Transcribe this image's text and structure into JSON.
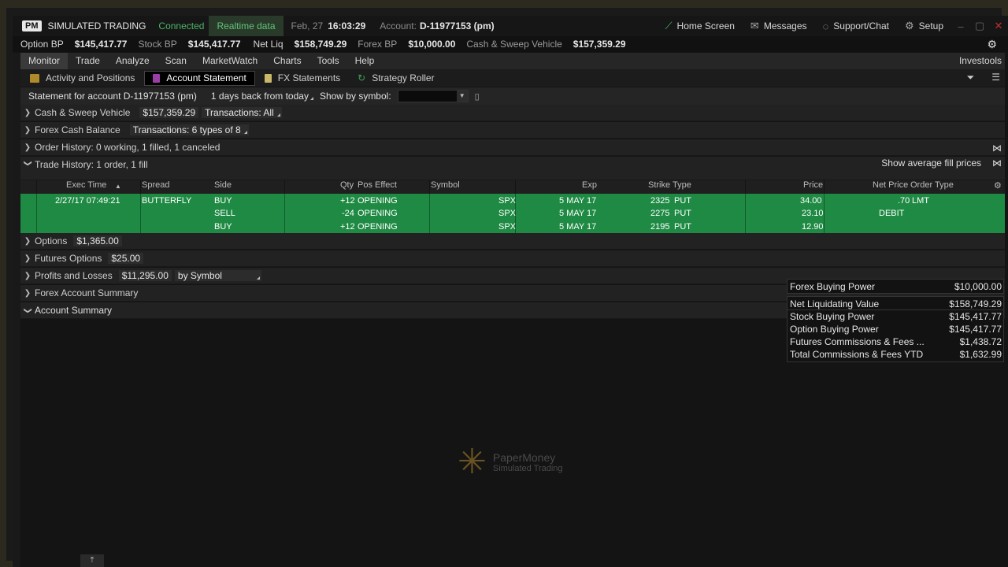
{
  "titlebar": {
    "logo": "PM",
    "title": "SIMULATED TRADING",
    "status": "Connected",
    "data_mode": "Realtime data",
    "date": "Feb, 27",
    "time": "16:03:29",
    "account_label": "Account:",
    "account": "D-11977153 (pm)",
    "home": "Home Screen",
    "messages": "Messages",
    "support": "Support/Chat",
    "setup": "Setup"
  },
  "balances": [
    {
      "label": "Option BP",
      "value": "$145,417.77"
    },
    {
      "label": "Stock BP",
      "value": "$145,417.77"
    },
    {
      "label": "Net Liq",
      "value": "$158,749.29"
    },
    {
      "label": "Forex BP",
      "value": "$10,000.00"
    },
    {
      "label": "Cash & Sweep Vehicle",
      "value": "$157,359.29"
    }
  ],
  "menu": {
    "items": [
      "Monitor",
      "Trade",
      "Analyze",
      "Scan",
      "MarketWatch",
      "Charts",
      "Tools",
      "Help"
    ],
    "right": "Investools"
  },
  "subtabs": [
    {
      "label": "Activity and Positions",
      "color": "#b08a2a"
    },
    {
      "label": "Account Statement",
      "color": "#9a3ea6"
    },
    {
      "label": "FX Statements",
      "color": "#c9b86a"
    },
    {
      "label": "Strategy Roller",
      "color": "#3fa15a"
    }
  ],
  "statement": {
    "title": "Statement for account D-11977153 (pm)",
    "range": "1 days back from today",
    "symbol_label": "Show by symbol:"
  },
  "sections": {
    "cash": {
      "label": "Cash & Sweep Vehicle",
      "value": "$157,359.29",
      "extra": "Transactions: All"
    },
    "forex_cash": {
      "label": "Forex Cash Balance",
      "extra": "Transactions: 6 types of 8"
    },
    "order_history": {
      "label": "Order History: 0 working, 1 filled, 1 canceled"
    },
    "trade_history": {
      "label": "Trade History: 1 order, 1 fill",
      "right": "Show average fill prices"
    },
    "options": {
      "label": "Options",
      "value": "$1,365.00"
    },
    "futures_options": {
      "label": "Futures Options",
      "value": "$25.00"
    },
    "pnl": {
      "label": "Profits and Losses",
      "value": "$11,295.00",
      "extra": "by Symbol"
    },
    "forex_summary": {
      "label": "Forex Account Summary"
    },
    "account_summary": {
      "label": "Account Summary"
    }
  },
  "trade_table": {
    "headers": {
      "exec_time": "Exec Time",
      "spread": "Spread",
      "side": "Side",
      "qty": "Qty",
      "pos_effect": "Pos Effect",
      "symbol": "Symbol",
      "exp": "Exp",
      "strike": "Strike",
      "type": "Type",
      "price": "Price",
      "net_price": "Net Price",
      "order_type": "Order Type"
    },
    "rows": [
      {
        "exec_time": "2/27/17 07:49:21",
        "spread": "BUTTERFLY",
        "side": "BUY",
        "qty": "+12",
        "pos_effect": "OPENING",
        "symbol": "SPX",
        "exp": "5 MAY 17",
        "strike": "2325",
        "type": "PUT",
        "price": "34.00",
        "net_price": ".70",
        "order_type": "LMT"
      },
      {
        "exec_time": "",
        "spread": "",
        "side": "SELL",
        "qty": "-24",
        "pos_effect": "OPENING",
        "symbol": "SPX",
        "exp": "5 MAY 17",
        "strike": "2275",
        "type": "PUT",
        "price": "23.10",
        "net_price": "DEBIT",
        "order_type": ""
      },
      {
        "exec_time": "",
        "spread": "",
        "side": "BUY",
        "qty": "+12",
        "pos_effect": "OPENING",
        "symbol": "SPX",
        "exp": "5 MAY 17",
        "strike": "2195",
        "type": "PUT",
        "price": "12.90",
        "net_price": "",
        "order_type": ""
      }
    ]
  },
  "forex_summary": [
    {
      "label": "Forex Buying Power",
      "value": "$10,000.00"
    }
  ],
  "account_summary": [
    {
      "label": "Net Liquidating Value",
      "value": "$158,749.29"
    },
    {
      "label": "Stock Buying Power",
      "value": "$145,417.77"
    },
    {
      "label": "Option Buying Power",
      "value": "$145,417.77"
    },
    {
      "label": "Futures Commissions & Fees ...",
      "value": "$1,438.72"
    },
    {
      "label": "Total Commissions & Fees YTD",
      "value": "$1,632.99"
    }
  ],
  "watermark": {
    "line1": "PaperMoney",
    "line2": "Simulated Trading"
  }
}
